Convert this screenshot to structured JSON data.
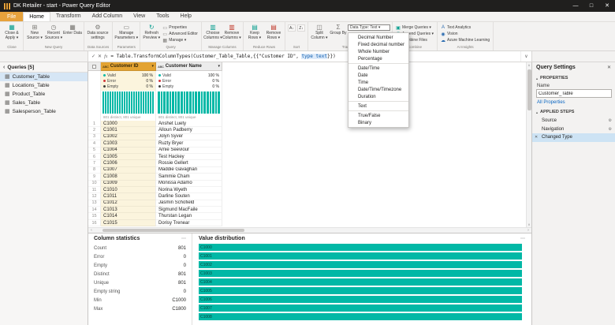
{
  "window": {
    "title": "DK Retailer - start - Power Query Editor"
  },
  "tabs": {
    "file": "File",
    "active": "Home",
    "items": [
      "Home",
      "Transform",
      "Add Column",
      "View",
      "Tools",
      "Help"
    ]
  },
  "ribbon": {
    "groups": {
      "close": {
        "label": "Close"
      },
      "new_query": {
        "label": "New Query"
      },
      "data_sources": {
        "label": "Data Sources"
      },
      "parameters": {
        "label": "Parameters"
      },
      "query": {
        "label": "Query"
      },
      "manage_columns": {
        "label": "Manage Columns"
      },
      "reduce_rows": {
        "label": "Reduce Rows"
      },
      "sort": {
        "label": "Sort"
      },
      "transform": {
        "label": "Transform"
      },
      "combine": {
        "label": "Combine"
      },
      "ai_insights": {
        "label": "AI Insights"
      }
    },
    "buttons": {
      "close_apply": "Close & Apply ▾",
      "new_source": "New Source ▾",
      "recent_sources": "Recent Sources ▾",
      "enter_data": "Enter Data",
      "data_source_settings": "Data source settings",
      "manage_parameters": "Manage Parameters ▾",
      "refresh_preview": "Refresh Preview ▾",
      "properties": "Properties",
      "advanced_editor": "Advanced Editor",
      "manage": "Manage ▾",
      "choose_columns": "Choose Columns ▾",
      "remove_columns": "Remove Columns ▾",
      "keep_rows": "Keep Rows ▾",
      "remove_rows": "Remove Rows ▾",
      "split_column": "Split Column ▾",
      "group_by": "Group By",
      "data_type": "Data Type: Text ▾",
      "merge_queries": "Merge Queries ▾",
      "append_queries": "Append Queries ▾",
      "combine_files": "Combine Files",
      "text_analytics": "Text Analytics",
      "vision": "Vision",
      "azure_ml": "Azure Machine Learning"
    }
  },
  "data_type_menu": {
    "items": [
      "Decimal Number",
      "Fixed decimal number",
      "Whole Number",
      "Percentage",
      "Date/Time",
      "Date",
      "Time",
      "Date/Time/Timezone",
      "Duration",
      "Text",
      "True/False",
      "Binary"
    ],
    "separator_after": [
      "Percentage",
      "Duration",
      "Text"
    ]
  },
  "formula_bar": {
    "pre": "= Table.TransformColumnTypes(Customer_Table_Table,{{\"Customer ID\", ",
    "highlight": "type text",
    "post": "}})"
  },
  "queries_panel": {
    "title": "Queries [5]",
    "items": [
      "Customer_Table",
      "Locations_Table",
      "Product_Table",
      "Sales_Table",
      "Salesperson_Table"
    ],
    "selected_index": 0
  },
  "grid": {
    "quality_labels": {
      "valid": "Valid",
      "error": "Error",
      "empty": "Empty"
    },
    "columns": [
      {
        "name": "Customer ID",
        "type_tag": "ABC",
        "selected": true,
        "valid": "100 %",
        "error": "0 %",
        "empty": "0 %",
        "profile": "801 distinct, 801 unique",
        "histogram_bars": 22
      },
      {
        "name": "Customer Name",
        "type_tag": "ABC",
        "selected": false,
        "valid": "100 %",
        "error": "0 %",
        "empty": "0 %",
        "profile": "801 distinct, 801 unique",
        "histogram_bars": 22
      }
    ],
    "rows": [
      [
        "C1000",
        "Anshet Luety"
      ],
      [
        "C1001",
        "Alloun Padberry"
      ],
      [
        "C1002",
        "Jolyn Syver"
      ],
      [
        "C1003",
        "Ruzty Bryer"
      ],
      [
        "C1004",
        "Amie Seeviour"
      ],
      [
        "C1005",
        "Test Hackey"
      ],
      [
        "C1006",
        "Rossie Gellert"
      ],
      [
        "C1007",
        "Maddie Gavaghan"
      ],
      [
        "C1008",
        "Sammie Cham"
      ],
      [
        "C1009",
        "Monissa Adamo"
      ],
      [
        "C1010",
        "Norina Wyeth"
      ],
      [
        "C1011",
        "Darline Souten"
      ],
      [
        "C1012",
        "Jasmin Schofield"
      ],
      [
        "C1013",
        "Sigmund MacFaile"
      ],
      [
        "C1014",
        "Thurstan Legan"
      ],
      [
        "C1015",
        "Dorisy Trenear"
      ]
    ]
  },
  "column_statistics": {
    "title": "Column statistics",
    "rows": [
      [
        "Count",
        "801"
      ],
      [
        "Error",
        "0"
      ],
      [
        "Empty",
        "0"
      ],
      [
        "Distinct",
        "801"
      ],
      [
        "Unique",
        "801"
      ],
      [
        "Empty string",
        "0"
      ],
      [
        "Min",
        "C1000"
      ],
      [
        "Max",
        "C1800"
      ]
    ]
  },
  "value_distribution": {
    "title": "Value distribution",
    "bars": [
      {
        "label": "C1000",
        "value": 1
      },
      {
        "label": "C1001",
        "value": 1
      },
      {
        "label": "C1002",
        "value": 1
      },
      {
        "label": "C1003",
        "value": 1
      },
      {
        "label": "C1004",
        "value": 1
      },
      {
        "label": "C1005",
        "value": 1
      },
      {
        "label": "C1006",
        "value": 1
      },
      {
        "label": "C1007",
        "value": 1
      },
      {
        "label": "C1008",
        "value": 1
      }
    ]
  },
  "query_settings": {
    "title": "Query Settings",
    "properties_section": "PROPERTIES",
    "name_label": "Name",
    "name_value": "Customer_Table",
    "all_properties": "All Properties",
    "steps_section": "APPLIED STEPS",
    "steps": [
      {
        "label": "Source",
        "gear": true
      },
      {
        "label": "Navigation",
        "gear": true
      },
      {
        "label": "Changed Type",
        "selected": true,
        "deletable": true
      }
    ]
  },
  "icons": {
    "minimize": "—",
    "maximize": "□",
    "close": "✕",
    "caret_down": "▾",
    "chevron_down": "∨",
    "chevron_left": "‹",
    "chevron_right": "›",
    "chevron_up": "∧",
    "check": "✓",
    "cancel": "✕",
    "fx": "fx",
    "dots": "⋯",
    "section_collapse": "▴",
    "gear": "⚙",
    "table": "▦",
    "table_check": "▦",
    "table_plus": "⊞",
    "clock": "◷",
    "refresh": "↻",
    "columns": "▥",
    "rows": "▤",
    "split": "◫",
    "sigma": "Σ",
    "merge": "▣",
    "append": "≡",
    "combine": "⊕",
    "vision": "◉",
    "cloud": "☁",
    "text_a": "A",
    "sort_az": "A↓",
    "sort_za": "Z↓",
    "doc": "▭"
  },
  "colors": {
    "teal": "#01b8a6",
    "gold_header": "#e3a333",
    "gold_cell": "#fbf4dd",
    "file_tab": "#e7a23c",
    "titlebar": "#201f1e",
    "step_selected": "#cde3f4",
    "query_selected": "#d6e6f5",
    "link": "#0a66c2",
    "error": "#d13438"
  }
}
